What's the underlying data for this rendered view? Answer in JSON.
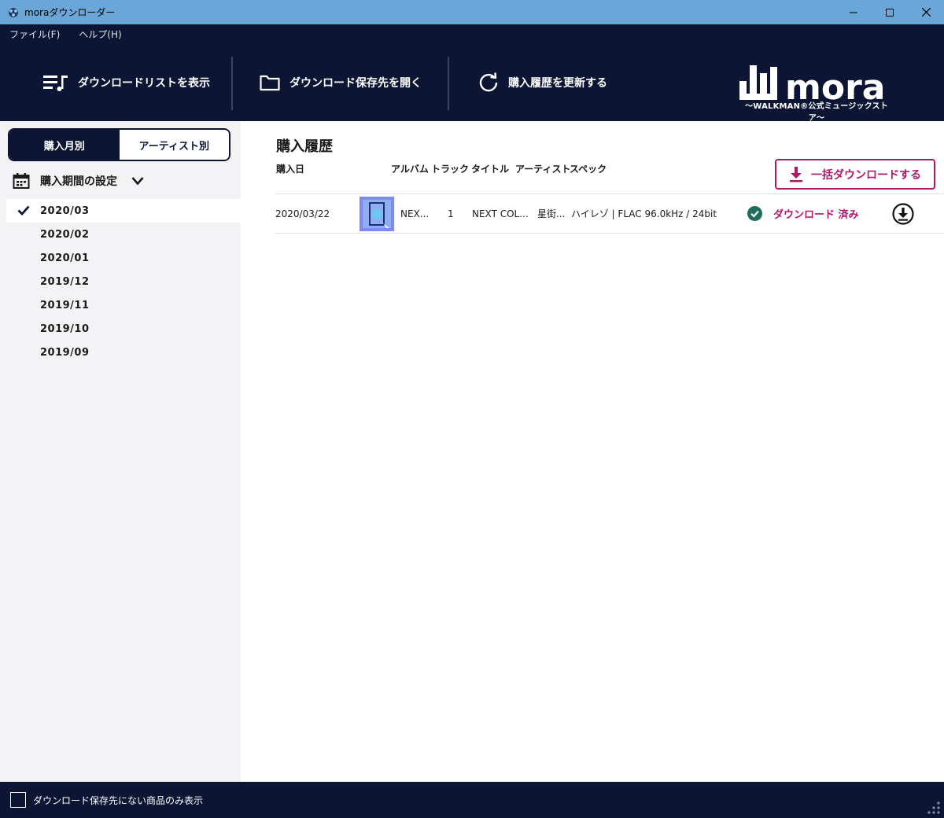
{
  "window": {
    "title": "moraダウンローダー"
  },
  "menu": {
    "items": [
      "ファイル(F)",
      "ヘルプ(H)"
    ]
  },
  "header": {
    "show_download_list": "ダウンロードリストを表示",
    "open_save_folder": "ダウンロード保存先を開く",
    "refresh_history": "購入履歴を更新する",
    "logo_text": "mora",
    "logo_sub": "〜WALKMAN®公式ミュージックストア〜"
  },
  "sidebar": {
    "tab_month": "購入月別",
    "tab_artist": "アーティスト別",
    "period_label": "購入期間の設定",
    "months": [
      "2020/03",
      "2020/02",
      "2020/01",
      "2019/12",
      "2019/11",
      "2019/10",
      "2019/09"
    ],
    "selected_month": "2020/03"
  },
  "main": {
    "title": "購入履歴",
    "columns": {
      "date": "購入日",
      "album": "アルバム",
      "track": "トラック",
      "title": "タイトル",
      "artist": "アーティスト",
      "spec": "スペック"
    },
    "bulk_download": "一括ダウンロードする",
    "rows": [
      {
        "date": "2020/03/22",
        "album": "NEX...",
        "track": "1",
        "title": "NEXT COL...",
        "artist": "星街...",
        "spec": "ハイレゾ | FLAC 96.0kHz / 24bit",
        "status": "ダウンロード 済み"
      }
    ]
  },
  "footer": {
    "only_missing_label": "ダウンロード保存先にない商品のみ表示"
  },
  "colors": {
    "navy": "#0c1533",
    "accent": "#b0186a",
    "titlebar": "#6aa7d8",
    "check_green": "#1f6e5c"
  }
}
